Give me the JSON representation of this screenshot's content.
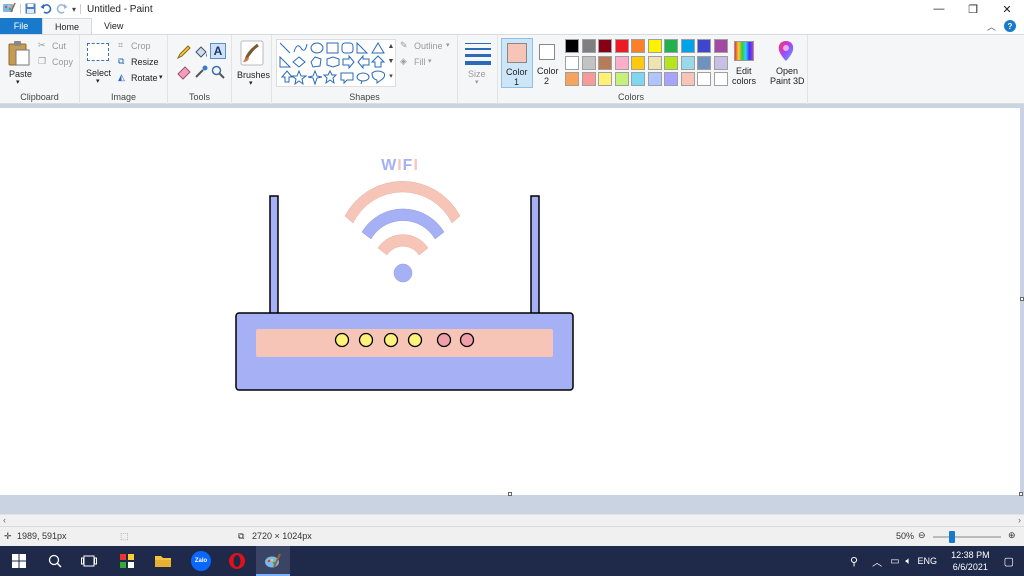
{
  "window": {
    "title": "Untitled - Paint"
  },
  "menu": {
    "file": "File",
    "home": "Home",
    "view": "View"
  },
  "clipboard": {
    "paste": "Paste",
    "cut": "Cut",
    "copy": "Copy",
    "label": "Clipboard"
  },
  "image": {
    "select": "Select",
    "crop": "Crop",
    "resize": "Resize",
    "rotate": "Rotate",
    "label": "Image"
  },
  "tools": {
    "label": "Tools"
  },
  "brushes": {
    "label": "Brushes"
  },
  "shapes": {
    "outline": "Outline",
    "fill": "Fill",
    "label": "Shapes"
  },
  "size": {
    "label": "Size"
  },
  "colors": {
    "color1_label": "Color",
    "color1_num": "1",
    "color1": "#f7c5b8",
    "color2_label": "Color",
    "color2_num": "2",
    "color2": "#ffffff",
    "edit": "Edit",
    "edit2": "colors",
    "paint3d": "Open",
    "paint3d2": "Paint 3D",
    "label": "Colors",
    "palette_row1": [
      "#000000",
      "#7f7f7f",
      "#880015",
      "#ed1c24",
      "#ff7f27",
      "#fff200",
      "#22b14c",
      "#00a2e8",
      "#3f48cc",
      "#a349a4"
    ],
    "palette_row2": [
      "#ffffff",
      "#c3c3c3",
      "#b97a57",
      "#ffaec9",
      "#ffc90e",
      "#efe4b0",
      "#b5e61d",
      "#99d9ea",
      "#7092be",
      "#c8bfe7"
    ],
    "palette_row3": [
      "#f7a35c",
      "#f89a9a",
      "#fff176",
      "#c5f07a",
      "#7fd6f0",
      "#b0c4ff",
      "#a7a3ff",
      "#f7c5b8",
      "#ffffff",
      "#ffffff"
    ]
  },
  "drawing": {
    "text": "WIFI",
    "router_color": "#a6b1f5",
    "panel_color": "#f7c5b8",
    "led_colors": [
      "#fdf27a",
      "#fdf27a",
      "#fdf27a",
      "#fdf27a",
      "#f0a0a8",
      "#f0a0a8"
    ]
  },
  "status": {
    "cursor": "1989, 591px",
    "size": "2720 × 1024px",
    "zoom": "50%"
  },
  "taskbar": {
    "lang": "ENG",
    "time": "12:38 PM",
    "date": "6/6/2021"
  }
}
